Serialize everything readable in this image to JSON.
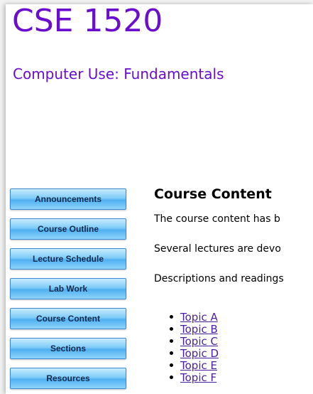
{
  "header": {
    "course_code": "CSE 1520",
    "course_name": "Computer Use: Fundamentals"
  },
  "sidebar": {
    "items": [
      {
        "label": "Announcements"
      },
      {
        "label": "Course Outline"
      },
      {
        "label": "Lecture Schedule"
      },
      {
        "label": "Lab Work"
      },
      {
        "label": "Course Content"
      },
      {
        "label": "Sections"
      },
      {
        "label": "Resources"
      }
    ]
  },
  "main": {
    "heading": "Course Content",
    "paragraphs": [
      "The course content has b",
      "Several lectures are devo",
      "Descriptions and readings"
    ],
    "topics": [
      {
        "label": "Topic A"
      },
      {
        "label": "Topic B"
      },
      {
        "label": "Topic C"
      },
      {
        "label": "Topic D"
      },
      {
        "label": "Topic E"
      },
      {
        "label": "Topic F"
      }
    ]
  },
  "colors": {
    "title": "#6a0dce",
    "link": "#4a1f9e",
    "button_blue": "#4fb0f0"
  }
}
